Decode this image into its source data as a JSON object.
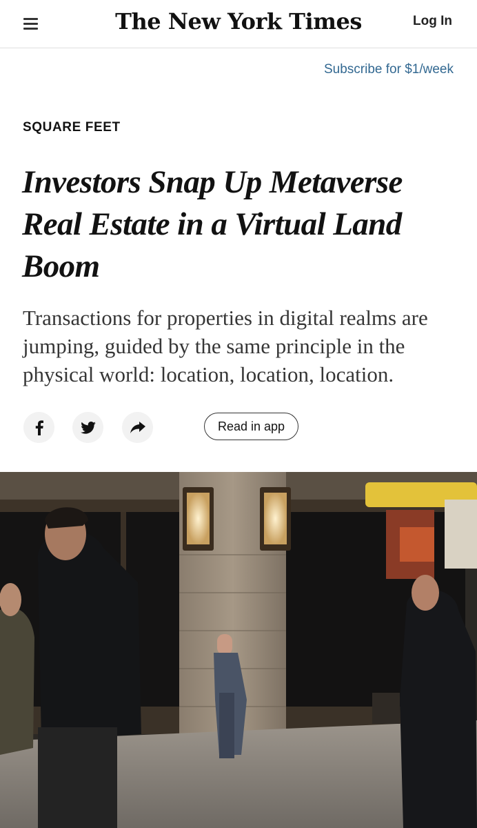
{
  "header": {
    "logo": "The New York Times",
    "login_label": "Log In",
    "menu_icon": "hamburger-menu-icon"
  },
  "subscribe": {
    "label": "Subscribe for $1/week"
  },
  "article": {
    "kicker": "SQUARE FEET",
    "headline": "Investors Snap Up Metaverse Real Estate in a Virtual Land Boom",
    "summary": "Transactions for properties in digital realms are jumping, guided by the same principle in the physical world: location, location, location."
  },
  "share": {
    "icons": [
      "facebook-icon",
      "twitter-icon",
      "share-arrow-icon"
    ],
    "read_in_app_label": "Read in app"
  },
  "colors": {
    "link": "#326891",
    "text": "#121212",
    "summary_text": "#363636",
    "button_bg": "#f2f2f2",
    "divider": "#dfdfdf"
  }
}
